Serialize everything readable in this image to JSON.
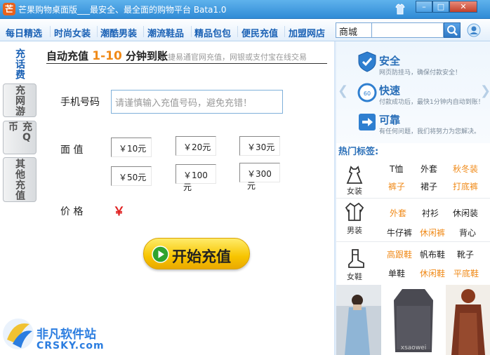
{
  "window": {
    "title": "芒果购物桌面版___最安全、最全面的购物平台 Bata1.0",
    "logo_text": "芒",
    "min_glyph": "–",
    "max_glyph": "□",
    "close_glyph": "✕"
  },
  "nav": {
    "items": [
      "每日精选",
      "时尚女装",
      "潮酷男装",
      "潮流鞋品",
      "精品包包",
      "便民充值",
      "加盟网店"
    ]
  },
  "search": {
    "select_value": "商城",
    "input_value": ""
  },
  "left_tabs": [
    "充话费",
    "充网游",
    "充Q币",
    "其他充值"
  ],
  "main": {
    "headline_a": "自动充值 ",
    "headline_b": "1-10",
    "headline_c": " 分钟到账",
    "headline_sub": "捷易通官网充值，网银或支付宝在线交易",
    "phone_label": "手机号码",
    "phone_placeholder": "请谨慎输入充值号码，避免充错！",
    "face_label": "面 值",
    "amounts": [
      "￥10元",
      "￥20元",
      "￥30元",
      "￥50元",
      "￥100元",
      "￥300元"
    ],
    "price_label": "价 格",
    "price_symbol": "￥",
    "start_button": "开始充值"
  },
  "right": {
    "promo": [
      {
        "title": "安全",
        "desc": "网页防挂马，确保付款安全！"
      },
      {
        "title": "快速",
        "desc": "付款成功后，最快1分钟内自动到账！"
      },
      {
        "title": "可靠",
        "desc": "有任何问题，我们将努力为您解决。"
      }
    ],
    "hot_title": "热门标签:",
    "categories": [
      {
        "label": "女装",
        "tags": [
          {
            "text": "T恤",
            "color": "dark"
          },
          {
            "text": "外套",
            "color": "dark"
          },
          {
            "text": "秋冬装",
            "color": "orange"
          },
          {
            "text": "裤子",
            "color": "orange"
          },
          {
            "text": "裙子",
            "color": "dark"
          },
          {
            "text": "打底裤",
            "color": "orange"
          }
        ]
      },
      {
        "label": "男装",
        "tags": [
          {
            "text": "外套",
            "color": "orange"
          },
          {
            "text": "衬衫",
            "color": "dark"
          },
          {
            "text": "休闲装",
            "color": "dark"
          },
          {
            "text": "牛仔裤",
            "color": "dark"
          },
          {
            "text": "休闲裤",
            "color": "orange"
          },
          {
            "text": "背心",
            "color": "dark"
          }
        ]
      },
      {
        "label": "女鞋",
        "tags": [
          {
            "text": "高跟鞋",
            "color": "orange"
          },
          {
            "text": "帆布鞋",
            "color": "dark"
          },
          {
            "text": "靴子",
            "color": "dark"
          },
          {
            "text": "单鞋",
            "color": "dark"
          },
          {
            "text": "休闲鞋",
            "color": "orange"
          },
          {
            "text": "平底鞋",
            "color": "orange"
          }
        ]
      }
    ],
    "photo_caption": "xsaowei"
  },
  "watermark": {
    "name": "非凡软件站",
    "domain": "CRSKY.com"
  },
  "colors": {
    "titlebar": "#3a95dd",
    "nav_text": "#1a61b5",
    "accent_orange": "#f08a18",
    "price_red": "#e02020",
    "button_yellow": "#f7c400"
  }
}
